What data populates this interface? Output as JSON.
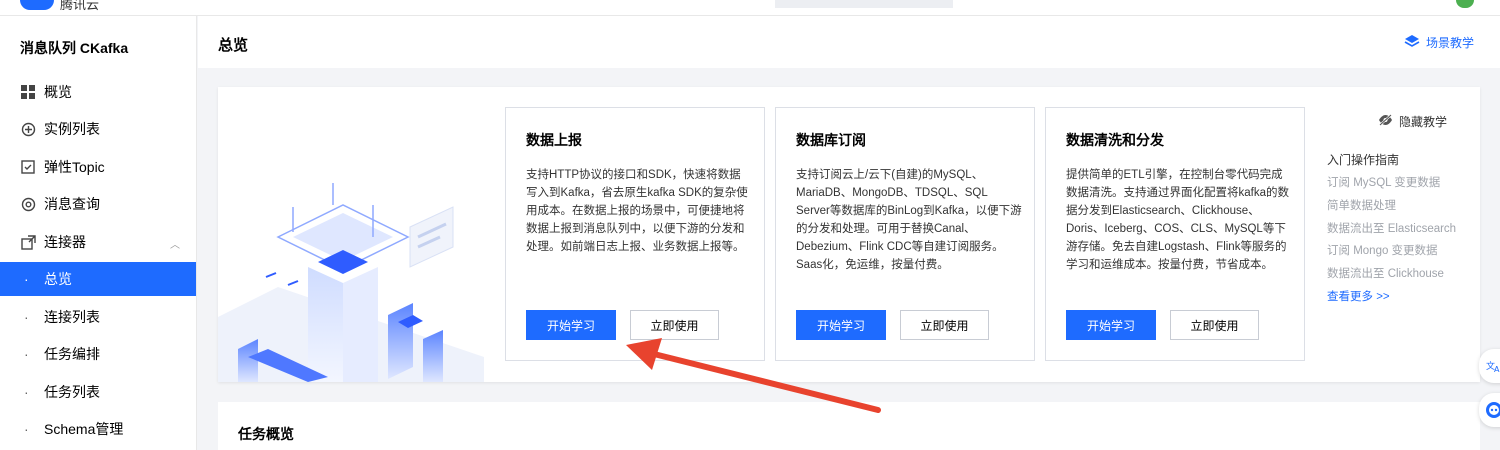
{
  "topbar": {
    "logo_text": "腾讯云"
  },
  "sidebar": {
    "product": "消息队列 CKafka",
    "items": [
      {
        "label": "概览",
        "icon": "grid-icon"
      },
      {
        "label": "实例列表",
        "icon": "instance-icon"
      },
      {
        "label": "弹性Topic",
        "icon": "checkbox-icon"
      },
      {
        "label": "消息查询",
        "icon": "at-icon"
      },
      {
        "label": "连接器",
        "icon": "connector-icon"
      }
    ],
    "sub_items": [
      {
        "label": "总览",
        "active": true
      },
      {
        "label": "连接列表"
      },
      {
        "label": "任务编排"
      },
      {
        "label": "任务列表"
      },
      {
        "label": "Schema管理"
      }
    ]
  },
  "header": {
    "title": "总览",
    "scene_link": "场景教学"
  },
  "cards": [
    {
      "title": "数据上报",
      "desc": "支持HTTP协议的接口和SDK，快速将数据写入到Kafka，省去原生kafka SDK的复杂使用成本。在数据上报的场景中，可便捷地将数据上报到消息队列中，以便下游的分发和处理。如前端日志上报、业务数据上报等。",
      "primary": "开始学习",
      "secondary": "立即使用"
    },
    {
      "title": "数据库订阅",
      "desc": "支持订阅云上/云下(自建)的MySQL、MariaDB、MongoDB、TDSQL、SQL Server等数据库的BinLog到Kafka，以便下游的分发和处理。可用于替换Canal、Debezium、Flink CDC等自建订阅服务。Saas化，免运维，按量付费。",
      "primary": "开始学习",
      "secondary": "立即使用"
    },
    {
      "title": "数据清洗和分发",
      "desc": "提供简单的ETL引擎，在控制台零代码完成数据清洗。支持通过界面化配置将kafka的数据分发到Elasticsearch、Clickhouse、Doris、Iceberg、COS、CLS、MySQL等下游存储。免去自建Logstash、Flink等服务的学习和运维成本。按量付费，节省成本。",
      "primary": "开始学习",
      "secondary": "立即使用"
    }
  ],
  "tips": {
    "hide_label": "隐藏教学",
    "heading": "入门操作指南",
    "links": [
      "订阅 MySQL 变更数据",
      "简单数据处理",
      "数据流出至 Elasticsearch",
      "订阅 Mongo 变更数据",
      "数据流出至 Clickhouse"
    ],
    "more": "查看更多 >>"
  },
  "task": {
    "title": "任务概览"
  },
  "colors": {
    "primary": "#1e6bff",
    "arrow": "#e8432e"
  }
}
